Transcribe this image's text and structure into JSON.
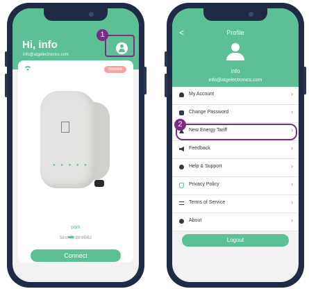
{
  "left": {
    "greeting": "Hi,  info",
    "email": "info@atgelectronics.com",
    "step_badge": "1",
    "remove_label": "remove",
    "charger_name": "park",
    "mac": "58:cf:79:20:05:62",
    "connect_label": "Connect",
    "pagination": {
      "count": 6,
      "active": 1
    }
  },
  "right": {
    "back": "<",
    "title": "Profile",
    "user": "info",
    "email": "info@atgelectronics.com",
    "step_badge": "2",
    "menu": [
      {
        "label": "My Account",
        "icon": "user-icon"
      },
      {
        "label": "Change Password",
        "icon": "lock-icon"
      },
      {
        "label": "New Energy Tariff",
        "icon": "tariff-icon"
      },
      {
        "label": "Feedback",
        "icon": "speaker-icon"
      },
      {
        "label": "Help & Support",
        "icon": "help-icon"
      },
      {
        "label": "Privacy Policy",
        "icon": "shield-icon"
      },
      {
        "label": "Terms of Service",
        "icon": "list-icon"
      },
      {
        "label": "About",
        "icon": "info-icon"
      }
    ],
    "logout_label": "Logout"
  },
  "colors": {
    "accent": "#5cbf96",
    "highlight": "#7a2d82",
    "remove": "#f6a3a3"
  }
}
